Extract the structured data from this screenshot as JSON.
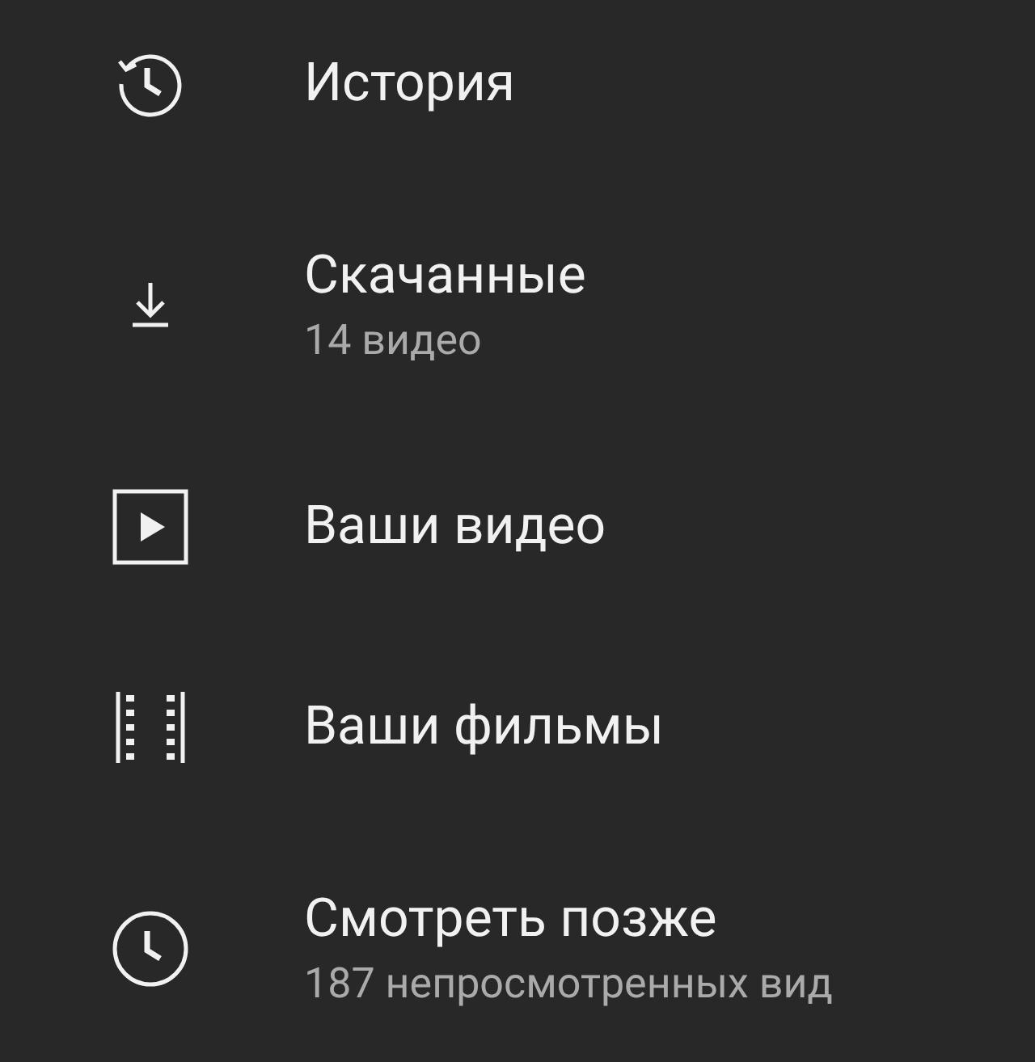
{
  "menu_items": [
    {
      "kind": "history",
      "title": "История"
    },
    {
      "kind": "download",
      "title": "Скачанные",
      "subtitle": "14 видео"
    },
    {
      "kind": "video",
      "title": "Ваши видео"
    },
    {
      "kind": "film",
      "title": "Ваши фильмы"
    },
    {
      "kind": "clock",
      "title": "Смотреть позже",
      "subtitle": "187 непросмотренных вид"
    }
  ]
}
